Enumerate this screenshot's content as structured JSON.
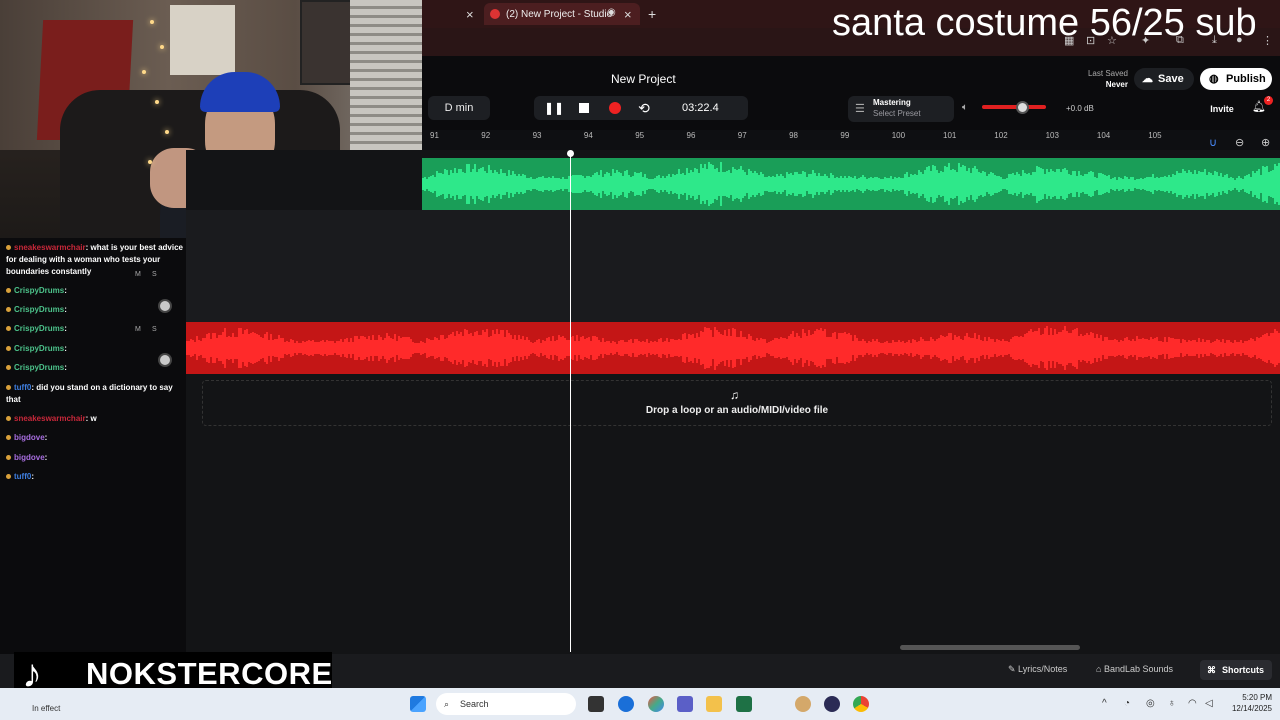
{
  "browser": {
    "tab_title": "(2) New Project - Studio",
    "new_tab": "+",
    "close_glyph": "×"
  },
  "overlay": {
    "title": "santa costume 56/25 sub"
  },
  "studio": {
    "project_name": "New Project",
    "key": "D min",
    "time": "03:22.4",
    "mastering_label": "Mastering",
    "mastering_sub": "Select Preset",
    "volume_db": "+0.0 dB",
    "volume_level": 0.62,
    "last_saved_label": "Last Saved",
    "last_saved_value": "Never",
    "save_label": "Save",
    "publish_label": "Publish",
    "invite_label": "Invite",
    "notification_count": "2",
    "ruler_ticks": [
      "91",
      "92",
      "93",
      "94",
      "95",
      "96",
      "97",
      "98",
      "99",
      "100",
      "101",
      "102",
      "103",
      "104",
      "105"
    ],
    "drop_text": "Drop a loop or an audio/MIDI/video file",
    "bottom": {
      "lyrics": "Lyrics/Notes",
      "sounds": "BandLab Sounds",
      "shortcuts": "Shortcuts"
    },
    "accent_green": "#1a9e58",
    "accent_red": "#c41616"
  },
  "chat": [
    {
      "user": "sneakeswarmchair",
      "msg": ": what is your best advice for dealing with a woman who tests your boundaries constantly",
      "color": "red"
    },
    {
      "user": "CrispyDrums",
      "msg": ": ",
      "color": "green"
    },
    {
      "user": "CrispyDrums",
      "msg": ": ",
      "color": "green"
    },
    {
      "user": "CrispyDrums",
      "msg": ": ",
      "color": "green"
    },
    {
      "user": "CrispyDrums",
      "msg": ": ",
      "color": "green"
    },
    {
      "user": "CrispyDrums",
      "msg": ": ",
      "color": "green"
    },
    {
      "user": "tuff0",
      "msg": ": did you stand on a dictionary to say that",
      "color": "blue"
    },
    {
      "user": "sneakeswarmchair",
      "msg": ": w",
      "color": "red"
    },
    {
      "user": "bigdove",
      "msg": ": ",
      "color": "purple"
    },
    {
      "user": "bigdove",
      "msg": ": ",
      "color": "purple"
    },
    {
      "user": "tuff0",
      "msg": ": ",
      "color": "blue"
    }
  ],
  "brand": {
    "name": "NOKSTERCORE",
    "logo": "tiktok-logo"
  },
  "taskbar": {
    "search_placeholder": "Search",
    "time": "5:20 PM",
    "date": "12/14/2025",
    "effect": "In effect"
  }
}
